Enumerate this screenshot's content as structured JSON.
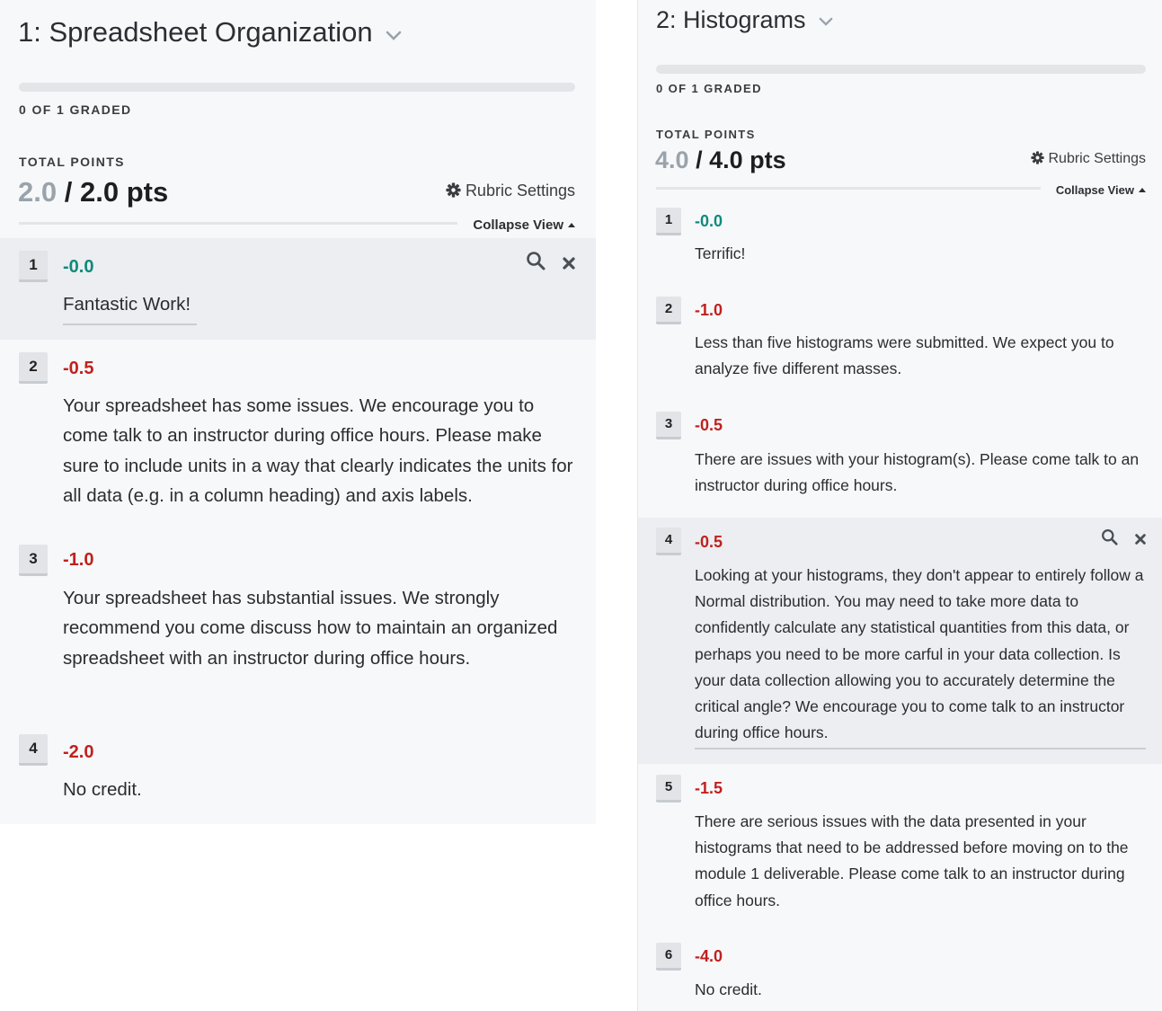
{
  "colors": {
    "accent_zero": "#0f8a7c",
    "accent_negative": "#c0211e",
    "muted_awarded": "#9aa3ab"
  },
  "icons": [
    "chevron-down-icon",
    "gear-icon",
    "caret-up-icon",
    "search-icon",
    "close-icon"
  ],
  "q1": {
    "title": "1: Spreadsheet Organization",
    "graded_label": "0 OF 1 GRADED",
    "graded_fraction": 0,
    "total_points_label": "TOTAL POINTS",
    "awarded": "2.0",
    "separator": "/",
    "possible": "2.0 pts",
    "rubric_settings_label": "Rubric Settings",
    "collapse_view_label": "Collapse View",
    "items": [
      {
        "key": "1",
        "points": "-0.0",
        "description": "Fantastic Work!"
      },
      {
        "key": "2",
        "points": "-0.5",
        "description": "Your spreadsheet has some issues. We encourage you to come talk to an instructor during office hours. Please make sure to include units in a way that clearly indicates the units for all data (e.g. in a column heading) and axis labels."
      },
      {
        "key": "3",
        "points": "-1.0",
        "description": "Your spreadsheet has substantial issues. We strongly recommend you come discuss how to maintain an organized spreadsheet with an instructor during office hours."
      },
      {
        "key": "4",
        "points": "-2.0",
        "description": "No credit."
      }
    ]
  },
  "q2": {
    "title": "2: Histograms",
    "graded_label": "0 OF 1 GRADED",
    "graded_fraction": 0,
    "total_points_label": "TOTAL POINTS",
    "awarded": "4.0",
    "separator": "/",
    "possible": "4.0 pts",
    "rubric_settings_label": "Rubric Settings",
    "collapse_view_label": "Collapse View",
    "items": [
      {
        "key": "1",
        "points": "-0.0",
        "description": "Terrific!"
      },
      {
        "key": "2",
        "points": "-1.0",
        "description": "Less than five histograms were submitted. We expect you to analyze five different masses."
      },
      {
        "key": "3",
        "points": "-0.5",
        "description": "There are issues with your histogram(s). Please come talk to an instructor during office hours."
      },
      {
        "key": "4",
        "points": "-0.5",
        "description": "Looking at your histograms, they don't appear to entirely follow a Normal distribution. You may need to take more data to confidently calculate any statistical quantities from this data, or perhaps you need to be more carful in your data collection. Is your data collection allowing you to accurately determine the critical angle? We encourage you to come talk to an instructor during office hours."
      },
      {
        "key": "5",
        "points": "-1.5",
        "description": "There are serious issues with the data presented in your histograms that need to be addressed before moving on to the module 1 deliverable. Please come talk to an instructor during office hours."
      },
      {
        "key": "6",
        "points": "-4.0",
        "description": "No credit."
      }
    ]
  }
}
